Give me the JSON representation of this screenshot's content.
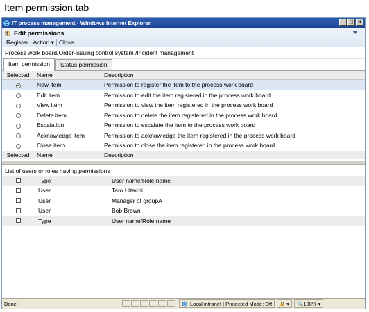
{
  "caption": "Item permission tab",
  "window": {
    "title": "IT process management - Windows Internet Explorer"
  },
  "header": {
    "title": "Edit permissions",
    "menu": [
      "Register",
      "Action ▾",
      "Close"
    ]
  },
  "path": "Process work board/Order-issuing control system /Incident management",
  "tabs": [
    "Item permission",
    "Status permission"
  ],
  "permissions": {
    "headers": {
      "selected": "Selected",
      "name": "Name",
      "description": "Description"
    },
    "rows": [
      {
        "name": "New item",
        "description": "Permission to register the item to the process work board",
        "selected": true
      },
      {
        "name": "Edit item",
        "description": "Permission to edit the item registered in the process work board",
        "selected": false
      },
      {
        "name": "View item",
        "description": "Permission to view the item registered in the process work board",
        "selected": false
      },
      {
        "name": "Delete item",
        "description": "Permission to delete the item registered in the process work board",
        "selected": false
      },
      {
        "name": "Escalation",
        "description": "Permission to escalate the item to the process work board",
        "selected": false
      },
      {
        "name": "Acknowledge item",
        "description": "Permission to acknowledge the item registered in the process work board",
        "selected": false
      },
      {
        "name": "Close item",
        "description": "Permission to close the item registered in the process work board",
        "selected": false
      }
    ]
  },
  "users": {
    "title": "List of users or roles having permissions",
    "headers": {
      "type": "Type",
      "name": "User name/Role name"
    },
    "rows": [
      {
        "type": "User",
        "name": "Taro Hitachi"
      },
      {
        "type": "User",
        "name": "Manager of groupA"
      },
      {
        "type": "User",
        "name": "Bob Brown"
      }
    ]
  },
  "status": {
    "text": "Done",
    "zone": "Local intranet | Protected Mode: Off",
    "zoom": "100%"
  }
}
